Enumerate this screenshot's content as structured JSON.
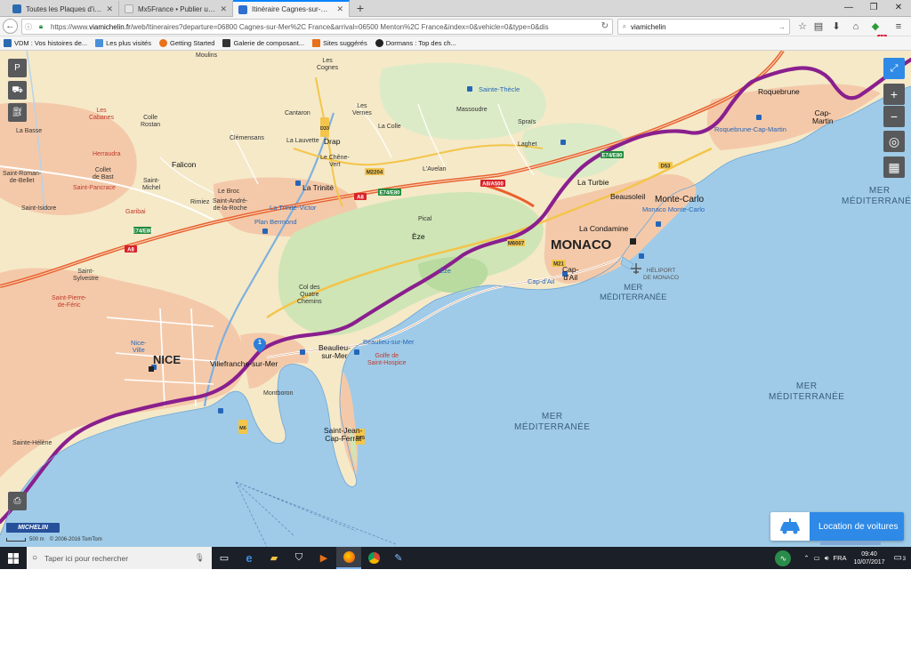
{
  "browser": {
    "tabs": [
      {
        "title": "Toutes les Plaques d'immatri",
        "favicon_color": "#2b6cb0"
      },
      {
        "title": "Mx5France • Publier une réponse",
        "favicon_color": "#e6e6e6"
      },
      {
        "title": "Itinéraire Cagnes-sur-Mer - M",
        "favicon_color": "#2e6fd1"
      }
    ],
    "url_domain": "viamichelin.fr",
    "url_prefix": "https://www.",
    "url_rest": "/web/Itineraires?departure=06800 Cagnes-sur-Mer%2C France&arrival=06500 Menton%2C France&index=0&vehicle=0&type=0&dis",
    "search_text": "viamichelin",
    "notification_count": "10"
  },
  "bookmarks": [
    {
      "label": "VDM : Vos histoires de...",
      "color": "#2b6cb0"
    },
    {
      "label": "Les plus visités",
      "color": "#4a90d9"
    },
    {
      "label": "Getting Started",
      "color": "#e8711a"
    },
    {
      "label": "Galerie de composant...",
      "color": "#333333"
    },
    {
      "label": "Sites suggérés",
      "color": "#e8711a"
    },
    {
      "label": "Dormans : Top des ch...",
      "color": "#222222"
    }
  ],
  "map": {
    "labels": {
      "nice": "NICE",
      "monaco": "MONACO",
      "mer1": "MER\nMÉDITERRANÉE",
      "mer2": "MER\nMÉDITERRANÉE",
      "mer3": "MER\nMÉDITERRANÉE",
      "mer4": "MER\nMÉDITERRANÉE",
      "villefranche": "Villefranche-sur-Mer",
      "beaulieu": "Beaulieu-\nsur-Mer",
      "beaulieu_blue": "Beaulieu-sur-Mer",
      "stjean": "Saint-Jean-\nCap-Ferrat",
      "montecarlo": "Monte-Carlo",
      "montecarlo_blue": "Monaco Monte-Carlo",
      "lacondamine": "La Condamine",
      "beausoleil": "Beausoleil",
      "laturbie": "La Turbie",
      "roquebrune": "Roquebrune",
      "roquebrune_cm": "Roquebrune-Cap-Martin",
      "capmartin": "Cap-\nMartin",
      "capdail": "Cap-\nd'Ail",
      "capdail_blue": "Cap-d'Ail",
      "eze": "Èze",
      "eze_town": "Èze",
      "latrinite": "La Trinité",
      "latrinite_victor": "La Trinité-Victor",
      "planbermond": "Plan Bermond",
      "drap": "Drap",
      "falicon": "Falicon",
      "standre": "Saint-André-\nde-la-Roche",
      "cantaron": "Cantaron",
      "stethecle": "Sainte-Thècle",
      "nice_ville": "Nice-\nVille",
      "heliport": "HÉLIPORT\nDE MONACO",
      "levernes": "Les\nVernes",
      "massoudre": "Massoudre",
      "lacolle": "La Colle",
      "laghet": "Laghet",
      "spraïs": "Spraïs",
      "lavelan": "L'Avelan",
      "lechene": "Le Chêne-\nVert",
      "pical": "Pical",
      "lesquatre": "Col des\nQuatre\nChemins",
      "moulins": "Moulins",
      "lescognes": "Les\nCognes",
      "stpancrace": "Saint-Pancrace",
      "stsylvestre": "Saint-\nSylvestre",
      "stroman": "Saint-Roman-\nde-Bellet",
      "herraudra": "Herraudra",
      "labasse": "La Basse",
      "lescabanes": "Les\nCabanes",
      "colbast": "Collet\nde Bast",
      "lalauvette": "La Lauvette",
      "clemensans": "Clémensans",
      "lebroc": "Le Broc",
      "rimiez": "Rimiez",
      "garibai": "Garibai",
      "stpierre": "Saint-Pierre-\nde-Féric",
      "sainteh": "Sainte-Hélène",
      "stisidore": "Saint-Isidore",
      "colle_rostan": "Colle\nRostan",
      "lesmoneghetti": "Cap",
      "stmichel": "Saint-\nMichel",
      "montboron": "Montboron",
      "golfe_stp": "Golfe de\nSaint-Hospice"
    },
    "road_badges": [
      "A8",
      "E80",
      "A8",
      "E74",
      "M6007",
      "D33",
      "D2204",
      "M2564",
      "D6007",
      "D37",
      "A500",
      "M6098",
      "D51",
      "N7"
    ]
  },
  "controls": {
    "fullscreen_icon": "fullscreen-icon",
    "zoom_in": "+",
    "zoom_out": "−",
    "locate_icon": "locate-icon",
    "layers_icon": "map-layers-icon",
    "car_rental_label": "Location de voitures",
    "scale": "500 m",
    "copyright": "© 2006-2016 TomTom",
    "michelin": "MICHELIN",
    "start_marker": "1"
  },
  "taskbar": {
    "search_placeholder": "Taper ici pour rechercher",
    "lang": "FRA",
    "time": "09:40",
    "date": "10/07/2017",
    "notifications": "3"
  },
  "colors": {
    "route": "#8a1f8e",
    "land": "#f5e9c8",
    "urban": "#f4c9a9",
    "forest": "#cfe5b5",
    "sea": "#9fcbe8",
    "motorway": "#e8602c",
    "accent": "#2e8ae6"
  }
}
